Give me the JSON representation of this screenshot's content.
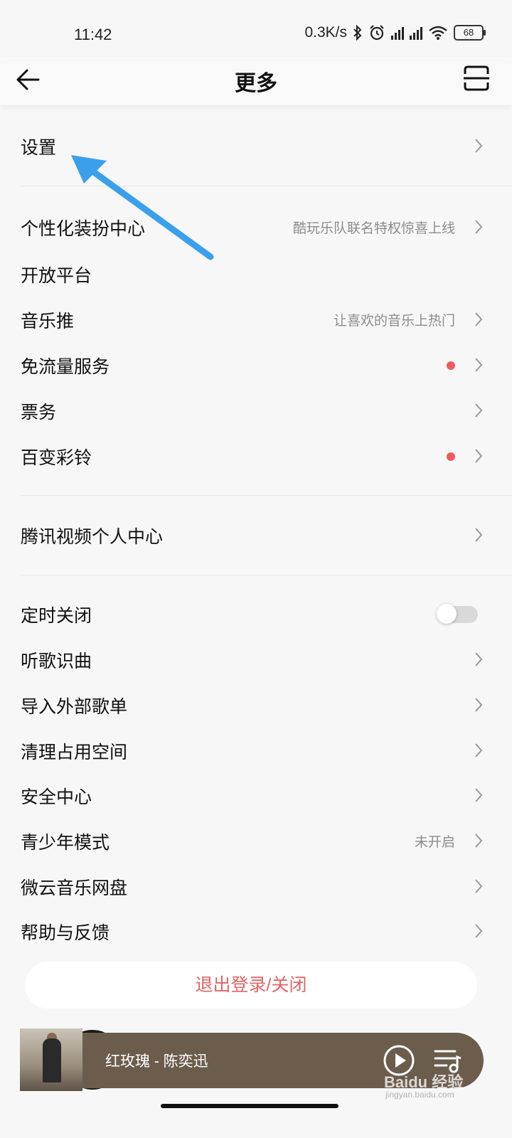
{
  "status_bar": {
    "time": "11:42",
    "net_speed": "0.3K/s",
    "battery": "68"
  },
  "header": {
    "title": "更多"
  },
  "menu": {
    "settings": {
      "label": "设置"
    },
    "personalize": {
      "label": "个性化装扮中心",
      "hint": "酷玩乐队联名特权惊喜上线"
    },
    "open_platform": {
      "label": "开放平台"
    },
    "music_promo": {
      "label": "音乐推",
      "hint": "让喜欢的音乐上热门"
    },
    "free_data": {
      "label": "免流量服务"
    },
    "tickets": {
      "label": "票务"
    },
    "ringtone": {
      "label": "百变彩铃"
    },
    "tencent_video": {
      "label": "腾讯视频个人中心"
    },
    "sleep_timer": {
      "label": "定时关闭",
      "on": false
    },
    "song_recognition": {
      "label": "听歌识曲"
    },
    "import_playlist": {
      "label": "导入外部歌单"
    },
    "clear_storage": {
      "label": "清理占用空间"
    },
    "security": {
      "label": "安全中心"
    },
    "teen_mode": {
      "label": "青少年模式",
      "hint": "未开启"
    },
    "weiyun": {
      "label": "微云音乐网盘"
    },
    "help": {
      "label": "帮助与反馈"
    }
  },
  "logout": {
    "label": "退出登录/关闭"
  },
  "player": {
    "song": "红玫瑰 - 陈奕迅"
  },
  "watermark": {
    "text": "Baidu 经验",
    "sub": "jingyan.baidu.com"
  },
  "colors": {
    "accent_red": "#e06466",
    "badge_red": "#f05a5a",
    "arrow_blue": "#3aa0ec",
    "player_bg": "#6b5c4c"
  },
  "icons": [
    "back-arrow-icon",
    "scan-icon",
    "chevron-right-icon",
    "play-icon",
    "playlist-icon",
    "bluetooth-icon",
    "alarm-icon",
    "signal-icon",
    "wifi-icon",
    "battery-icon"
  ]
}
